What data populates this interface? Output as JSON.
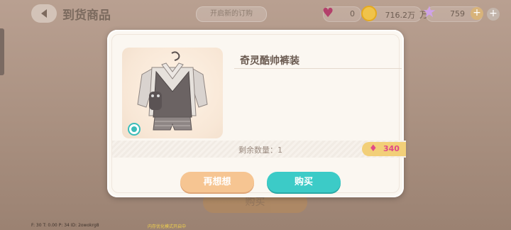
{
  "header": {
    "title": "到货商品",
    "center_button": "开启新的订购"
  },
  "currencies": {
    "hearts": "0",
    "coins": "716.2万",
    "coin_suffix": "万",
    "stars": "759"
  },
  "modal": {
    "item_name": "奇灵酷帅裤装",
    "remaining_label": "剩余数量：1",
    "price": "340",
    "cancel_label": "再想想",
    "buy_label": "购买"
  },
  "background": {
    "buy_label": "购买"
  },
  "debug": {
    "stats": "F: 30  T: 0.00  P: 34  ID: 2owokrg8",
    "notice": "内存优化模式开启中"
  },
  "colors": {
    "accent_teal": "#3ccbc7",
    "accent_peach": "#f6c592",
    "gem_pink": "#e14a87",
    "price_bg": "#f2cf78"
  },
  "icons": [
    "back-arrow-icon",
    "heart-gem-icon",
    "coin-icon",
    "star-icon",
    "plus-icon",
    "eye-icon",
    "pink-gem-icon"
  ]
}
